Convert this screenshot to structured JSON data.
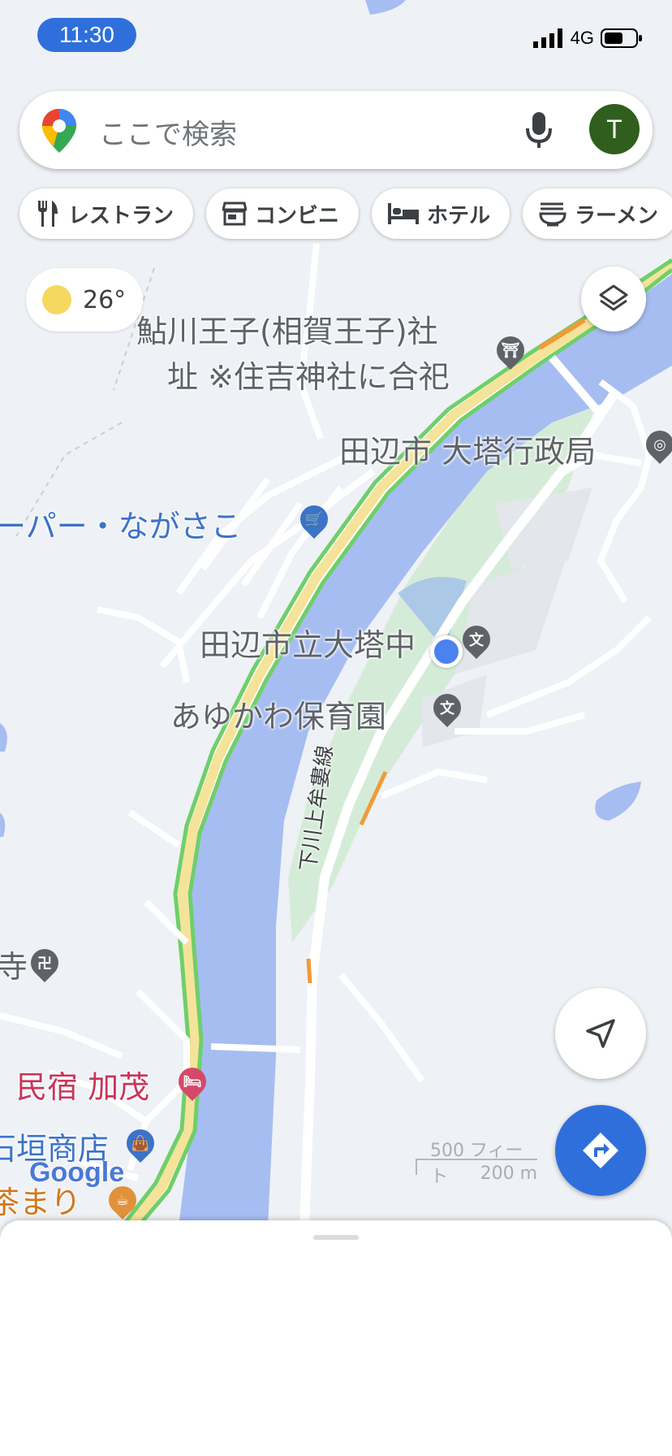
{
  "status_bar": {
    "time": "11:30",
    "network": "4G"
  },
  "search": {
    "placeholder": "ここで検索",
    "avatar_letter": "T"
  },
  "chips": [
    {
      "label": "レストラン",
      "icon": "restaurant-icon"
    },
    {
      "label": "コンビニ",
      "icon": "store-icon"
    },
    {
      "label": "ホテル",
      "icon": "hotel-icon"
    },
    {
      "label": "ラーメン",
      "icon": "ramen-icon"
    }
  ],
  "weather": {
    "temp": "26°"
  },
  "map": {
    "places": {
      "shrine_line1": "鮎川王子(相賀王子)社",
      "shrine_line2": "址 ※住吉神社に合祀",
      "office": "田辺市 大塔行政局",
      "supermarket": "ーパー・ながさこ",
      "school": "田辺市立大塔中",
      "nursery": "あゆかわ保育園",
      "road": "下川上牟婁線",
      "temple": "寺",
      "inn": "民宿 加茂",
      "shop": "石垣商店",
      "cafe": "茶まり"
    },
    "scale": {
      "imperial": "500 フィート",
      "metric": "200 m"
    },
    "attribution": "Google"
  },
  "colors": {
    "water": "#a6bdf2",
    "park": "#d4ecd7",
    "accent": "#2f6fdc"
  }
}
